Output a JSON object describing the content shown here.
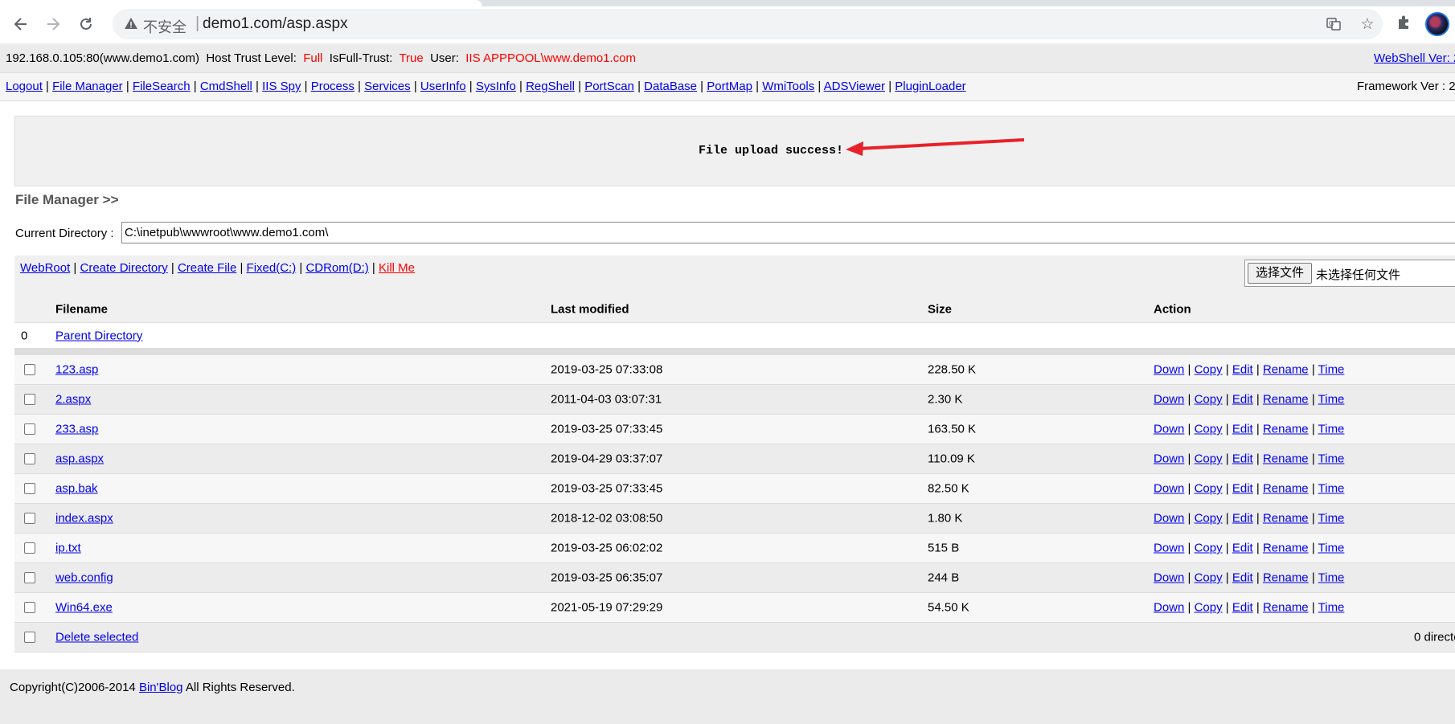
{
  "browser": {
    "security_label": "不安全",
    "url": "demo1.com/asp.aspx"
  },
  "info": {
    "host": "192.168.0.105:80(www.demo1.com)",
    "trust_label": "Host Trust Level:",
    "trust_value": "Full",
    "fulltrust_label": "IsFull-Trust:",
    "fulltrust_value": "True",
    "user_label": "User:",
    "user_value": "IIS APPPOOL\\www.demo1.com",
    "webshell_ver": "WebShell Ver: 2"
  },
  "menu": {
    "items": [
      "Logout",
      "File Manager",
      "FileSearch",
      "CmdShell",
      "IIS Spy",
      "Process",
      "Services",
      "UserInfo",
      "SysInfo",
      "RegShell",
      "PortScan",
      "DataBase",
      "PortMap",
      "WmiTools",
      "ADSViewer",
      "PluginLoader"
    ],
    "framework_ver": "Framework Ver : 2"
  },
  "message": "File upload success!",
  "file_manager": {
    "title": "File Manager >>",
    "current_dir_label": "Current Directory :",
    "current_dir_value": "C:\\inetpub\\wwwroot\\www.demo1.com\\",
    "tools": [
      "WebRoot",
      "Create Directory",
      "Create File",
      "Fixed(C:)",
      "CDRom(D:)"
    ],
    "kill_me": "Kill Me",
    "choose_file_button": "选择文件",
    "no_file_text": "未选择任何文件",
    "headers": {
      "filename": "Filename",
      "modified": "Last modified",
      "size": "Size",
      "action": "Action"
    },
    "parent_index": "0",
    "parent_label": "Parent Directory",
    "files": [
      {
        "name": "123.asp",
        "modified": "2019-03-25 07:33:08",
        "size": "228.50 K"
      },
      {
        "name": "2.aspx",
        "modified": "2011-04-03 03:07:31",
        "size": "2.30 K"
      },
      {
        "name": "233.asp",
        "modified": "2019-03-25 07:33:45",
        "size": "163.50 K"
      },
      {
        "name": "asp.aspx",
        "modified": "2019-04-29 03:37:07",
        "size": "110.09 K"
      },
      {
        "name": "asp.bak",
        "modified": "2019-03-25 07:33:45",
        "size": "82.50 K"
      },
      {
        "name": "index.aspx",
        "modified": "2018-12-02 03:08:50",
        "size": "1.80 K"
      },
      {
        "name": "ip.txt",
        "modified": "2019-03-25 06:02:02",
        "size": "515 B"
      },
      {
        "name": "web.config",
        "modified": "2019-03-25 06:35:07",
        "size": "244 B"
      },
      {
        "name": "Win64.exe",
        "modified": "2021-05-19 07:29:29",
        "size": "54.50 K"
      }
    ],
    "actions": [
      "Down",
      "Copy",
      "Edit",
      "Rename",
      "Time"
    ],
    "delete_selected": "Delete selected",
    "dir_count": "0 directo"
  },
  "footer": {
    "prefix": "Copyright(C)2006-2014",
    "link": "Bin'Blog",
    "suffix": "All Rights Reserved."
  },
  "colors": {
    "link": "#0000ee",
    "alert": "#ff0000",
    "arrow": "#e8212a"
  }
}
